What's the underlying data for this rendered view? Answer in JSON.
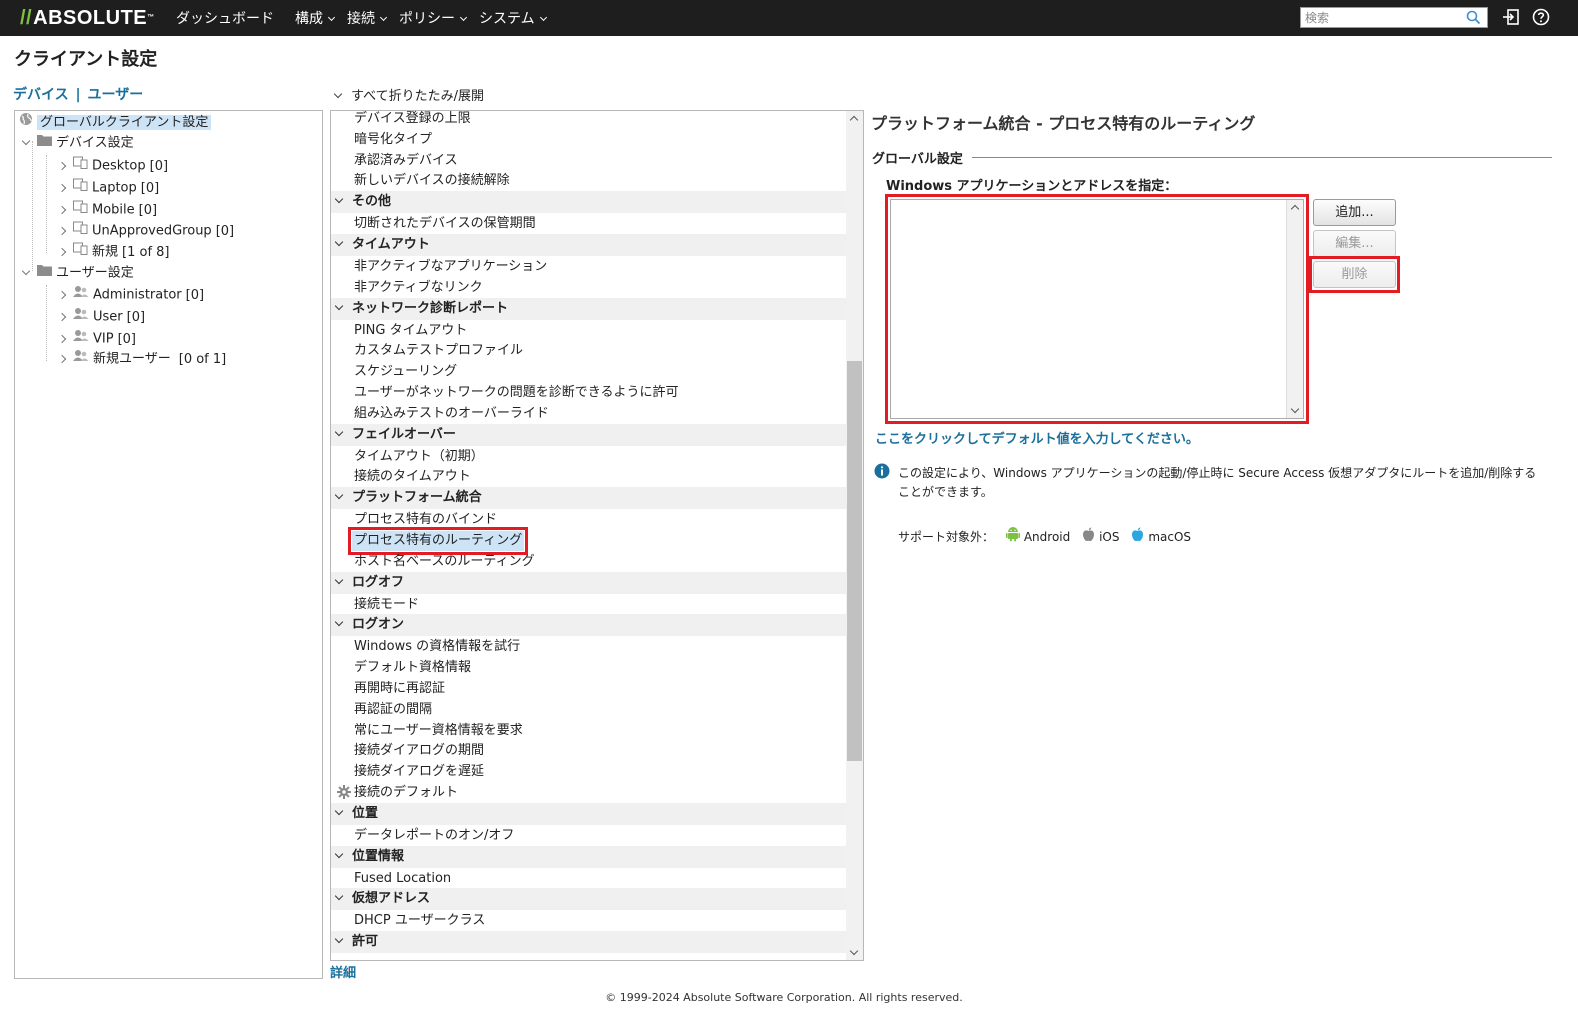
{
  "header": {
    "logo": "ABSOLUTE",
    "nav": [
      {
        "label": "ダッシュボード",
        "dropdown": false
      },
      {
        "label": "構成",
        "dropdown": true
      },
      {
        "label": "接続",
        "dropdown": true
      },
      {
        "label": "ポリシー",
        "dropdown": true
      },
      {
        "label": "システム",
        "dropdown": true
      }
    ],
    "search_placeholder": "検索",
    "icons": [
      "search-icon",
      "logout-icon",
      "help-icon"
    ]
  },
  "page": {
    "title": "クライアント設定",
    "links": {
      "devices": "デバイス",
      "separator": "|",
      "users": "ユーザー"
    }
  },
  "tree": {
    "root": "グローバルクライアント設定",
    "device_group": "デバイス設定",
    "devices": [
      {
        "label": "Desktop",
        "count": "[0]"
      },
      {
        "label": "Laptop",
        "count": "[0]"
      },
      {
        "label": "Mobile",
        "count": "[0]"
      },
      {
        "label": "UnApprovedGroup",
        "count": "[0]"
      },
      {
        "label": "新規",
        "count": "[1 of 8]"
      }
    ],
    "user_group": "ユーザー設定",
    "users": [
      {
        "label": "Administrator",
        "count": "[0]"
      },
      {
        "label": "User",
        "count": "[0]"
      },
      {
        "label": "VIP",
        "count": "[0]"
      },
      {
        "label": "新規ユーザー",
        "count": "[0 of 1]"
      }
    ]
  },
  "settings": {
    "collapse_all": "すべて折りたたみ/展開",
    "details": "詳細",
    "rows": [
      {
        "type": "item",
        "label": "デバイス登録の上限"
      },
      {
        "type": "item",
        "label": "暗号化タイプ"
      },
      {
        "type": "item",
        "label": "承認済みデバイス"
      },
      {
        "type": "item",
        "label": "新しいデバイスの接続解除"
      },
      {
        "type": "header",
        "label": "その他"
      },
      {
        "type": "item",
        "label": "切断されたデバイスの保管期間"
      },
      {
        "type": "header",
        "label": "タイムアウト"
      },
      {
        "type": "item",
        "label": "非アクティブなアプリケーション"
      },
      {
        "type": "item",
        "label": "非アクティブなリンク"
      },
      {
        "type": "header",
        "label": "ネットワーク診断レポート"
      },
      {
        "type": "item",
        "label": "PING タイムアウト"
      },
      {
        "type": "item",
        "label": "カスタムテストプロファイル"
      },
      {
        "type": "item",
        "label": "スケジューリング"
      },
      {
        "type": "item",
        "label": "ユーザーがネットワークの問題を診断できるように許可"
      },
      {
        "type": "item",
        "label": "組み込みテストのオーバーライド"
      },
      {
        "type": "header",
        "label": "フェイルオーバー"
      },
      {
        "type": "item",
        "label": "タイムアウト（初期）"
      },
      {
        "type": "item",
        "label": "接続のタイムアウト"
      },
      {
        "type": "header",
        "label": "プラットフォーム統合"
      },
      {
        "type": "item",
        "label": "プロセス特有のバインド"
      },
      {
        "type": "item",
        "label": "プロセス特有のルーティング",
        "selected": true
      },
      {
        "type": "item",
        "label": "ホスト名ベースのルーティング"
      },
      {
        "type": "header",
        "label": "ログオフ"
      },
      {
        "type": "item",
        "label": "接続モード"
      },
      {
        "type": "header",
        "label": "ログオン"
      },
      {
        "type": "item",
        "label": "Windows の資格情報を試行"
      },
      {
        "type": "item",
        "label": "デフォルト資格情報"
      },
      {
        "type": "item",
        "label": "再開時に再認証"
      },
      {
        "type": "item",
        "label": "再認証の間隔"
      },
      {
        "type": "item",
        "label": "常にユーザー資格情報を要求"
      },
      {
        "type": "item",
        "label": "接続ダイアログの期間"
      },
      {
        "type": "item",
        "label": "接続ダイアログを遅延"
      },
      {
        "type": "item",
        "label": "接続のデフォルト",
        "icon": "gear-icon"
      },
      {
        "type": "header",
        "label": "位置"
      },
      {
        "type": "item",
        "label": "データレポートのオン/オフ"
      },
      {
        "type": "header",
        "label": "位置情報"
      },
      {
        "type": "item",
        "label": "Fused Location"
      },
      {
        "type": "header",
        "label": "仮想アドレス"
      },
      {
        "type": "item",
        "label": "DHCP ユーザークラス"
      },
      {
        "type": "header",
        "label": "許可"
      }
    ]
  },
  "detail": {
    "title": "プラットフォーム統合 - プロセス特有のルーティング",
    "section": "グローバル設定",
    "field_label": "Windows アプリケーションとアドレスを指定：",
    "field_value": "",
    "buttons": {
      "add": "追加...",
      "edit": "編集...",
      "delete": "削除"
    },
    "default_link": "ここをクリックしてデフォルト値を入力してください。",
    "info_text": "この設定により、Windows アプリケーションの起動/停止時に Secure Access 仮想アダプタにルートを追加/削除することができます。",
    "unsupported_label": "サポート対象外：",
    "platforms": [
      "Android",
      "iOS",
      "macOS"
    ]
  },
  "colors": {
    "topbar": "#1e1e1e",
    "link": "#1a6f9c",
    "highlight": "#e31b23",
    "selection": "#cde4f7",
    "android": "#7cc242",
    "apple_macos": "#29a8e0"
  },
  "footer": "© 1999-2024 Absolute Software Corporation. All rights reserved."
}
